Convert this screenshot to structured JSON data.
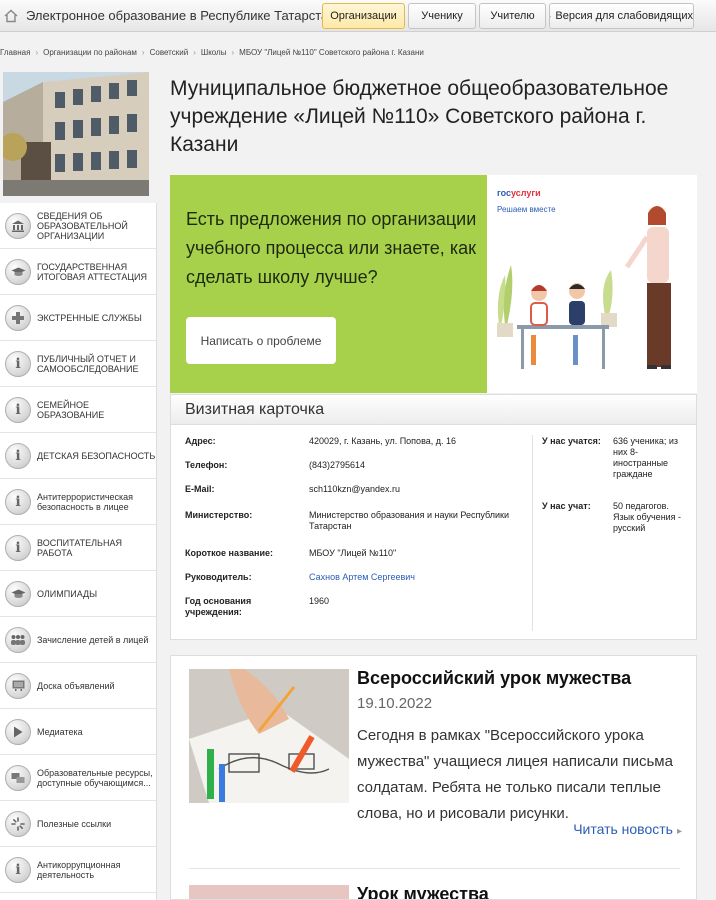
{
  "header": {
    "site_title": "Электронное образование в Республике Татарстан",
    "tabs": [
      "Организации",
      "Ученику",
      "Учителю"
    ],
    "accessible_version": "Версия для слабовидящих"
  },
  "breadcrumb": [
    "Главная",
    "Организации по районам",
    "Советский",
    "Школы",
    "МБОУ \"Лицей №110\" Советского района г. Казани"
  ],
  "sidebar": {
    "items": [
      {
        "label": "СВЕДЕНИЯ ОБ ОБРАЗОВАТЕЛЬНОЙ ОРГАНИЗАЦИИ",
        "icon": "building-icon"
      },
      {
        "label": "ГОСУДАРСТВЕННАЯ ИТОГОВАЯ АТТЕСТАЦИЯ",
        "icon": "graduation-cap-icon"
      },
      {
        "label": "ЭКСТРЕННЫЕ СЛУЖБЫ",
        "icon": "medical-cross-icon"
      },
      {
        "label": "ПУБЛИЧНЫЙ ОТЧЕТ И САМООБСЛЕДОВАНИЕ",
        "icon": "info-icon"
      },
      {
        "label": "СЕМЕЙНОЕ ОБРАЗОВАНИЕ",
        "icon": "info-icon"
      },
      {
        "label": "ДЕТСКАЯ БЕЗОПАСНОСТЬ",
        "icon": "info-icon"
      },
      {
        "label": "Антитеррористическая безопасность в лицее",
        "icon": "info-icon"
      },
      {
        "label": "ВОСПИТАТЕЛЬНАЯ РАБОТА",
        "icon": "info-icon"
      },
      {
        "label": "ОЛИМПИАДЫ",
        "icon": "graduation-cap-icon"
      },
      {
        "label": "Зачисление детей в лицей",
        "icon": "people-icon"
      },
      {
        "label": "Доска объявлений",
        "icon": "board-icon"
      },
      {
        "label": "Медиатека",
        "icon": "play-icon"
      },
      {
        "label": "Образовательные ресурсы, доступные обучающимся...",
        "icon": "resources-icon"
      },
      {
        "label": "Полезные ссылки",
        "icon": "links-icon"
      },
      {
        "label": "Антикоррупционная деятельность",
        "icon": "info-icon"
      }
    ]
  },
  "main": {
    "title": "Муниципальное бюджетное общеобразовательное учреждение «Лицей №110» Советского района г. Казани"
  },
  "banner": {
    "text": "Есть предложения по организации учебного процесса или знаете, как сделать школу лучше?",
    "button": "Написать о проблеме",
    "logo_part1": "гос",
    "logo_part2": "услуги",
    "logo_sub": "Решаем вместе"
  },
  "card": {
    "title": "Визитная карточка",
    "rows": [
      {
        "label": "Адрес:",
        "value": "420029, г. Казань, ул. Попова, д. 16"
      },
      {
        "label": "Телефон:",
        "value": "(843)2795614"
      },
      {
        "label": "E-Mail:",
        "value": "sch110kzn@yandex.ru"
      },
      {
        "label": "Министерство:",
        "value": "Министерство образования и науки Республики Татарстан"
      },
      {
        "label": "Короткое название:",
        "value": "МБОУ \"Лицей №110\""
      },
      {
        "label": "Руководитель:",
        "value": "Сахнов Артем Сергеевич"
      },
      {
        "label": "Год основания учреждения:",
        "value": "1960"
      }
    ],
    "right": [
      {
        "label": "У нас учатся:",
        "value": "636 ученика; из них 8- иностранные граждане"
      },
      {
        "label": "У нас учат:",
        "value": "50 педагогов. Язык обучения - русский"
      }
    ]
  },
  "news": [
    {
      "title": "Всероссийский урок мужества",
      "date": "19.10.2022",
      "text": "Сегодня в рамках \"Всероссийского урока мужества\" учащиеся лицея написали письма солдатам. Ребята не только писали теплые слова, но и рисовали рисунки.",
      "read_more": "Читать новость"
    },
    {
      "title": "Урок мужества"
    }
  ],
  "colors": {
    "accent_green": "#a7d14b",
    "link_blue": "#2b5db5",
    "active_tab": "#ffe9a6"
  }
}
